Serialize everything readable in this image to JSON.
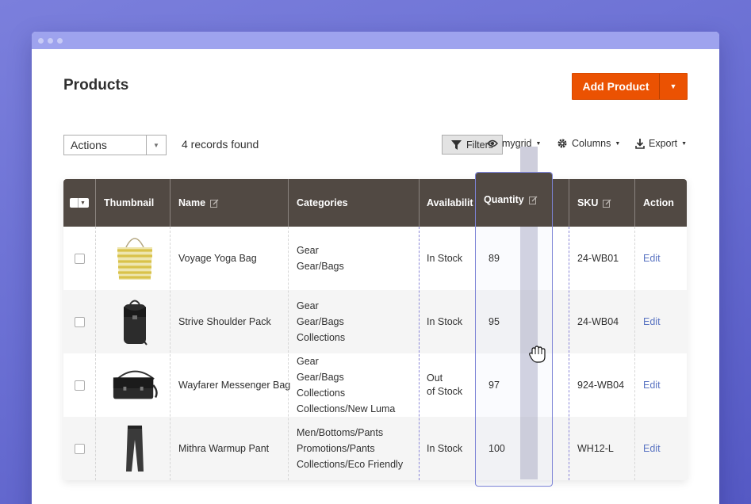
{
  "page": {
    "title": "Products"
  },
  "header": {
    "add_button_label": "Add Product"
  },
  "toolbar": {
    "actions_label": "Actions",
    "records_text": "4 records found",
    "filters_label": "Filters",
    "view_label": "mygrid",
    "columns_label": "Columns",
    "export_label": "Export"
  },
  "grid": {
    "columns": {
      "thumbnail": "Thumbnail",
      "name": "Name",
      "categories": "Categories",
      "availability": "Availabilit",
      "quantity": "Quantity",
      "sku": "SKU",
      "action": "Action"
    },
    "rows": [
      {
        "name": "Voyage Yoga Bag",
        "categories": [
          "Gear",
          "Gear/Bags"
        ],
        "availability": [
          "In Stock"
        ],
        "quantity": "89",
        "sku": "24-WB01",
        "action": "Edit",
        "thumb": "yoga-bag"
      },
      {
        "name": "Strive Shoulder Pack",
        "categories": [
          "Gear",
          "Gear/Bags",
          "Collections"
        ],
        "availability": [
          "In Stock"
        ],
        "quantity": "95",
        "sku": "24-WB04",
        "action": "Edit",
        "thumb": "backpack"
      },
      {
        "name": "Wayfarer Messenger Bag",
        "categories": [
          "Gear",
          "Gear/Bags",
          "Collections",
          "Collections/New Luma"
        ],
        "availability": [
          "Out",
          "of Stock"
        ],
        "quantity": "97",
        "sku": "924-WB04",
        "action": "Edit",
        "thumb": "messenger-bag"
      },
      {
        "name": "Mithra Warmup Pant",
        "categories": [
          "Men/Bottoms/Pants",
          "Promotions/Pants",
          "Collections/Eco Friendly"
        ],
        "availability": [
          "In Stock"
        ],
        "quantity": "100",
        "sku": "WH12-L",
        "action": "Edit",
        "thumb": "pant"
      }
    ]
  },
  "colors": {
    "accent": "#eb5202",
    "header_bg": "#514943",
    "highlight_border": "#7c83d6",
    "link": "#5a74c2"
  }
}
